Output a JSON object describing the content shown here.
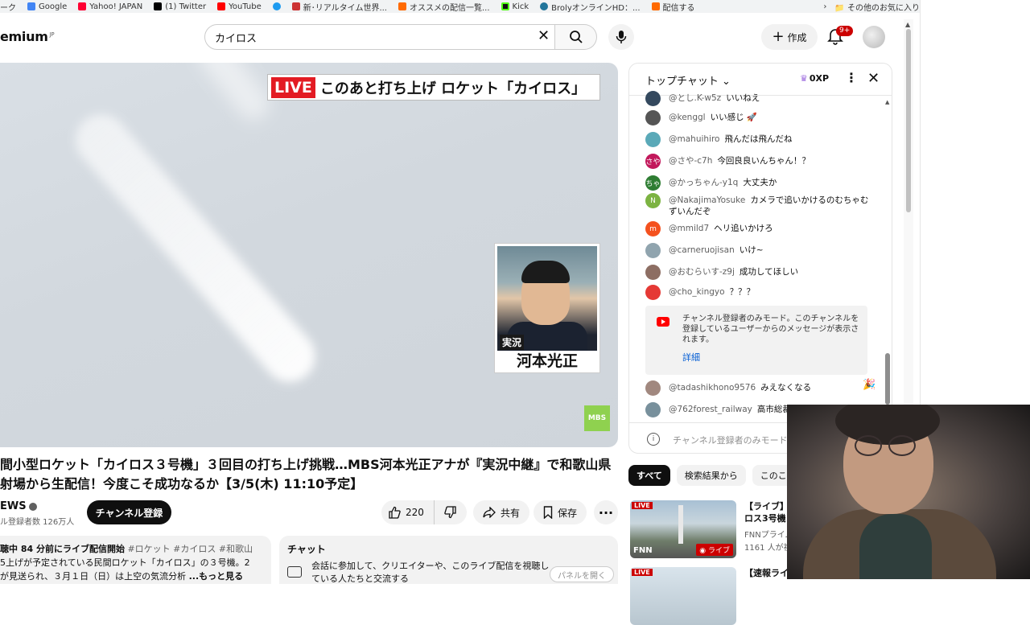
{
  "bookmarks": {
    "items": [
      {
        "label": "ーク",
        "color": "#888888"
      },
      {
        "label": "Google",
        "color": "#4285f4"
      },
      {
        "label": "Yahoo! JAPAN",
        "color": "#ff0033"
      },
      {
        "label": "(1) Twitter",
        "color": "#000000"
      },
      {
        "label": "YouTube",
        "color": "#ff0000"
      },
      {
        "label": "",
        "color": "#1d9bf0"
      },
      {
        "label": "新･リアルタイム世界...",
        "color": "#cc3333"
      },
      {
        "label": "オススメの配信一覧...",
        "color": "#ff6a00"
      },
      {
        "label": "Kick",
        "color": "#53fc18"
      },
      {
        "label": "BrolyオンラインHD：...",
        "color": "#21759b"
      },
      {
        "label": "配信する",
        "color": "#ff6a00"
      }
    ],
    "other": "その他のお気に入り"
  },
  "masthead": {
    "logo": "emium",
    "logo_region": "JP",
    "search_value": "カイロス",
    "create_label": "作成",
    "notification_badge": "9+"
  },
  "video": {
    "banner_live": "LIVE",
    "banner_text": "このあと打ち上げ ロケット「カイロス」",
    "announcer_label": "実況",
    "announcer_name": "河本光正",
    "station_logo": "MBS"
  },
  "title": {
    "line1": "間小型ロケット「カイロス３号機」３回目の打ち上げ挑戦…MBS河本光正アナが『実況中継』で和歌山県",
    "line2": "射場から生配信！今度こそ成功なるか【3/5(木) 11:10予定】"
  },
  "channel": {
    "name": "EWS",
    "subscribers": "ル登録者数 126万人",
    "subscribe_label": "チャンネル登録"
  },
  "actions": {
    "likes": "220",
    "share": "共有",
    "save": "保存"
  },
  "description": {
    "stats": "聴中  84 分前にライブ配信開始",
    "tags": "#ロケット #カイロス #和歌山",
    "line2": "5上げが予定されている民間ロケット「カイロス」の３号機。2",
    "line3": "が見送られ、３月１日（日）は上空の気流分析",
    "more": "...もっと見る"
  },
  "chat_replay": {
    "heading": "チャット",
    "text": "会話に参加して、クリエイターや、このライブ配信を視聴している人たちと交流する",
    "panel_button": "パネルを開く"
  },
  "live_chat": {
    "title": "トップチャット",
    "xp": "0XP",
    "messages": [
      {
        "user": "@とし.K-w5z",
        "text": "いいねえ",
        "initial": "",
        "color": "#34495e"
      },
      {
        "user": "@kenggl",
        "text": "いい感じ 🚀",
        "initial": "",
        "color": "#555555"
      },
      {
        "user": "@mahuihiro",
        "text": "飛んだは飛んだね",
        "initial": "",
        "color": "#5aa9b8"
      },
      {
        "user": "@さや-c7h",
        "text": "今回良良いんちゃん！？",
        "initial": "さや",
        "color": "#c2185b"
      },
      {
        "user": "@かっちゃん-y1q",
        "text": "大丈夫か",
        "initial": "ちゃ",
        "color": "#2e7d32"
      },
      {
        "user": "@NakajimaYosuke",
        "text": "カメラで追いかけるのむちゃむずいんだぞ",
        "initial": "N",
        "color": "#7cb342"
      },
      {
        "user": "@mmild7",
        "text": "ヘリ追いかけろ",
        "initial": "m",
        "color": "#f4511e"
      },
      {
        "user": "@carneruojisan",
        "text": "いけ~",
        "initial": "",
        "color": "#90a4ae"
      },
      {
        "user": "@おむらいす-z9j",
        "text": "成功してほしい",
        "initial": "",
        "color": "#8d6e63"
      },
      {
        "user": "@cho_kingyo",
        "text": "？？？",
        "initial": "",
        "color": "#e53935"
      }
    ],
    "notice_text": "チャンネル登録者のみモード。このチャンネルを登録しているユーザーからのメッセージが表示されます。",
    "notice_link": "詳細",
    "messages_after": [
      {
        "user": "@tadashikhono9576",
        "text": "みえなくなる",
        "initial": "",
        "color": "#a1887f"
      },
      {
        "user": "@762forest_railway",
        "text": "高市総裁",
        "initial": "",
        "color": "#78909c"
      }
    ],
    "input_placeholder": "チャンネル登録者のみモード"
  },
  "chips": [
    "すべて",
    "検索結果から",
    "このこ"
  ],
  "recommendations": [
    {
      "title1": "【ライブ】",
      "title2": "ロス3号機",
      "channel": "FNNプライム",
      "views": "1161 人が視",
      "badge": "LIVE",
      "overlay": "ライブ"
    },
    {
      "title1": "【速報ライ",
      "title2": "",
      "channel": "",
      "views": "",
      "badge": "LIVE",
      "overlay": ""
    }
  ]
}
